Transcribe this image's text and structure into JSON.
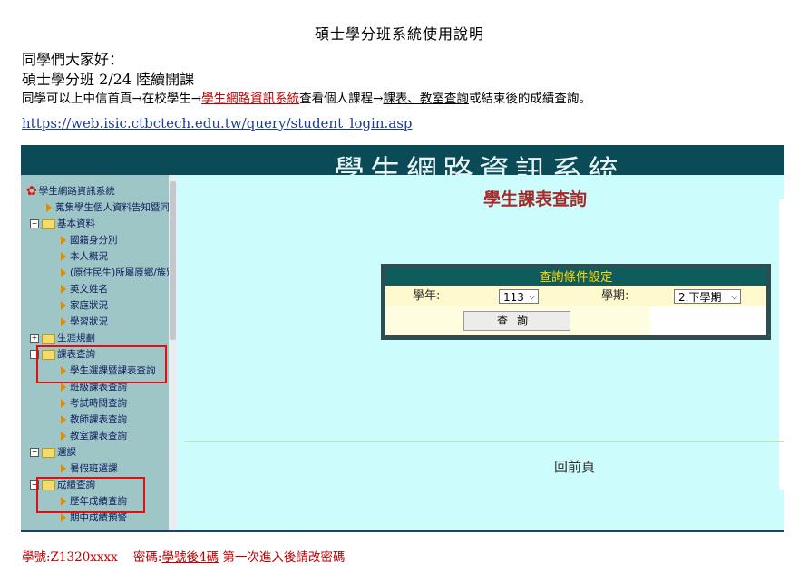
{
  "doc": {
    "title": "碩士學分班系統使用說明",
    "greeting": "同學們大家好：",
    "line2": "碩士學分班 2/24 陸續開課",
    "line3_a": "同學可以上中信首頁→在校學生→",
    "line3_link": "學生網路資訊系統",
    "line3_b": "查看個人課程→",
    "line3_ul": "課表、教室查詢",
    "line3_c": "或結束後的成績查詢。",
    "url": "https://web.isic.ctbctech.edu.tw/query/student_login.asp"
  },
  "system": {
    "banner_title": "學生網路資訊系統",
    "sidebar": {
      "root": "學生網路資訊系統",
      "items": [
        "蒐集學生個人資料告知暨同意書",
        "基本資料",
        "國籍身分別",
        "本人概況",
        "(原住民生)所屬原鄉/族別",
        "英文姓名",
        "家庭狀況",
        "學習狀況",
        "生涯規劃",
        "課表查詢",
        "學生選課暨課表查詢",
        "班級課表查詢",
        "考試時間查詢",
        "教師課表查詢",
        "教室課表查詢",
        "選課",
        "暑假班選課",
        "成績查詢",
        "歷年成績查詢",
        "期中成績預警"
      ]
    },
    "main_title": "學生課表查詢",
    "query": {
      "header": "查詢條件設定",
      "year_label": "學年:",
      "year_value": "113",
      "term_label": "學期:",
      "term_value": "2.下學期",
      "button": "查詢"
    },
    "back_label": "回前頁"
  },
  "footer": {
    "id_text": "學號:Z1320xxxx",
    "pw_label": "密碼:",
    "pw_ul": "學號後4碼",
    "pw_note": "第一次進入後請改密碼"
  },
  "colors": {
    "banner": "#0b4b57",
    "main_bg": "#ccfcfc",
    "highlight": "#e01010"
  }
}
